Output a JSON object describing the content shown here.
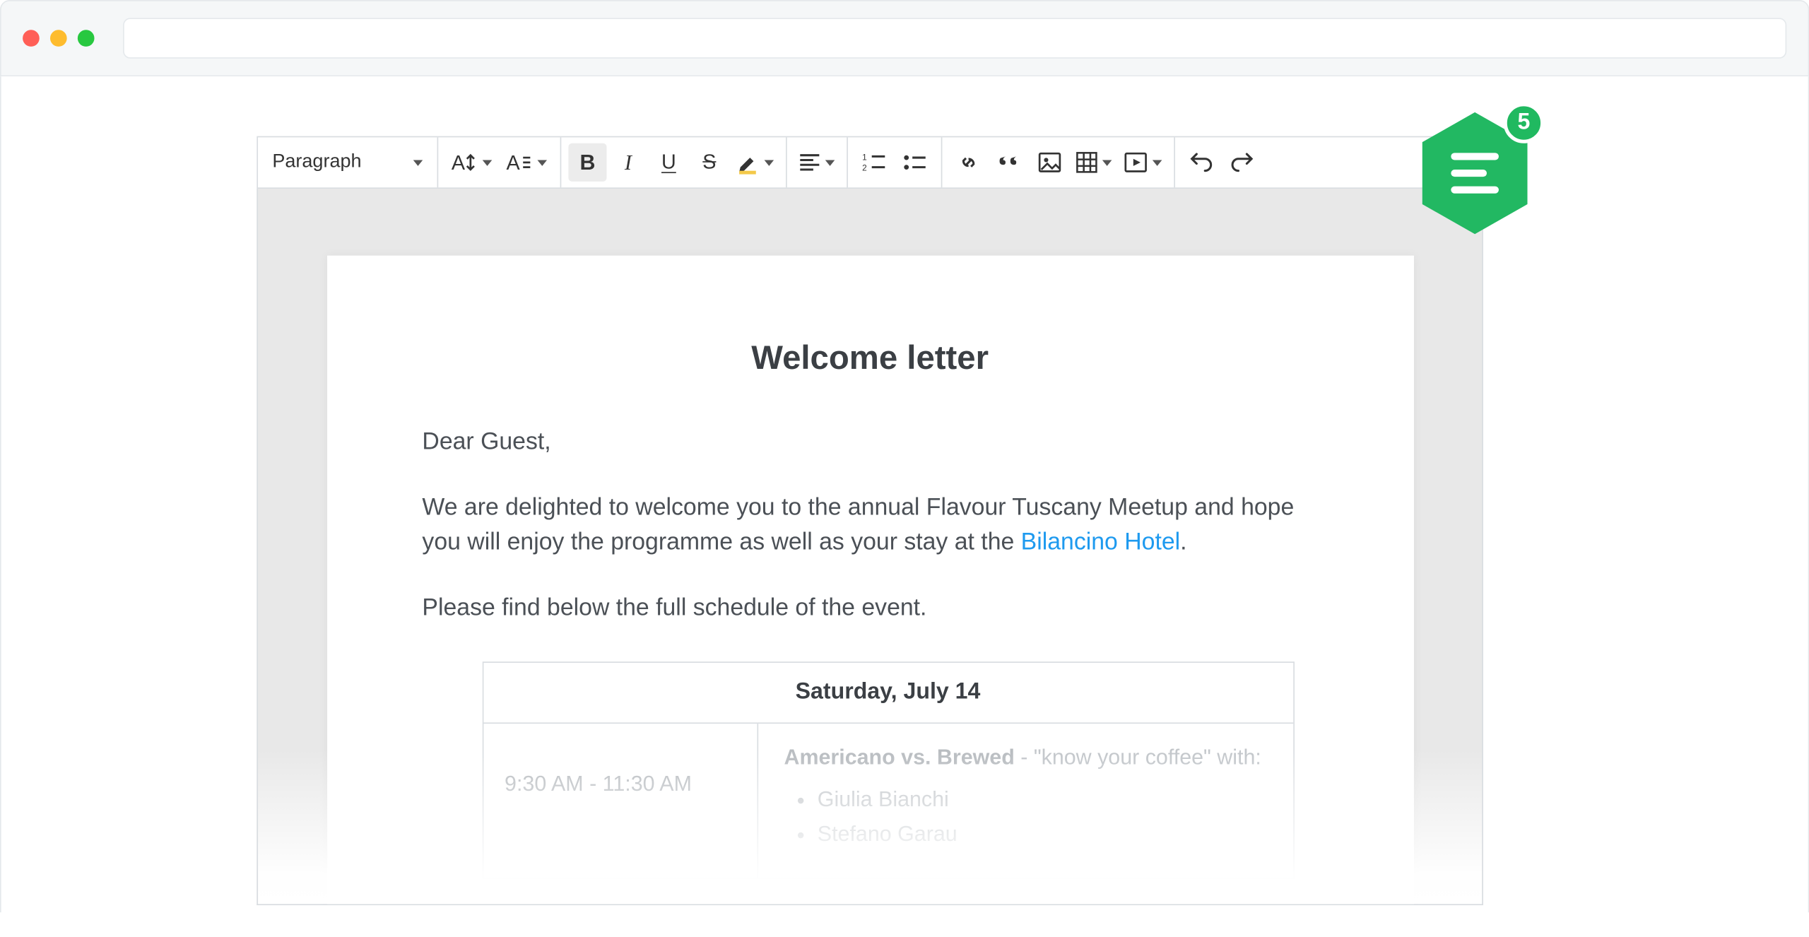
{
  "toolbar": {
    "heading": "Paragraph"
  },
  "badge": {
    "count": "5"
  },
  "doc": {
    "title": "Welcome letter",
    "greeting": "Dear Guest,",
    "intro_pre": "We are delighted to welcome you to the annual Flavour Tuscany Meetup and hope you will enjoy the programme as well as your stay at the ",
    "intro_link": "Bilancino Hotel",
    "intro_post": ".",
    "schedule_intro": "Please find below the full schedule of the event.",
    "schedule": {
      "day": "Saturday, July 14",
      "rows": [
        {
          "time": "9:30 AM - 11:30 AM",
          "title": "Americano vs. Brewed",
          "subtitle": " - \"know your coffee\" with:",
          "speakers": [
            "Giulia Bianchi",
            "Stefano Garau"
          ]
        }
      ]
    }
  }
}
